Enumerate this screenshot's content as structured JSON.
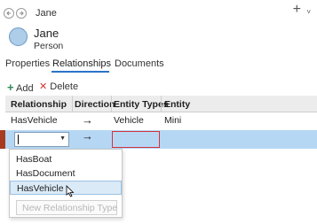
{
  "nav": {
    "back_icon": "back-arrow-icon",
    "forward_icon": "forward-arrow-icon",
    "breadcrumb": "Jane",
    "add_icon": "+",
    "menu_icon": "˅"
  },
  "entity": {
    "name": "Jane",
    "type": "Person",
    "avatar_color": "#aecde9"
  },
  "tabs": [
    {
      "label": "Properties",
      "active": false
    },
    {
      "label": "Relationships",
      "active": true
    },
    {
      "label": "Documents",
      "active": false
    }
  ],
  "toolbar": {
    "add_label": "Add",
    "add_color": "#2e8b57",
    "delete_label": "Delete",
    "delete_color": "#d13438"
  },
  "grid": {
    "columns": [
      "Relationship",
      "Direction",
      "Entity Types",
      "Entity"
    ],
    "rows": [
      {
        "relationship": "HasVehicle",
        "direction": "-->",
        "entity_types": "Vehicle",
        "entity": "Mini"
      },
      {
        "relationship": "",
        "direction": "-->",
        "entity_types": "",
        "entity": ""
      }
    ],
    "selected_row_color": "#b6d7f4",
    "invalid_border_color": "#d1333c"
  },
  "dropdown": {
    "options": [
      "HasBoat",
      "HasDocument",
      "HasVehicle"
    ],
    "highlighted": "HasVehicle",
    "new_button_label": "New Relationship Type"
  }
}
